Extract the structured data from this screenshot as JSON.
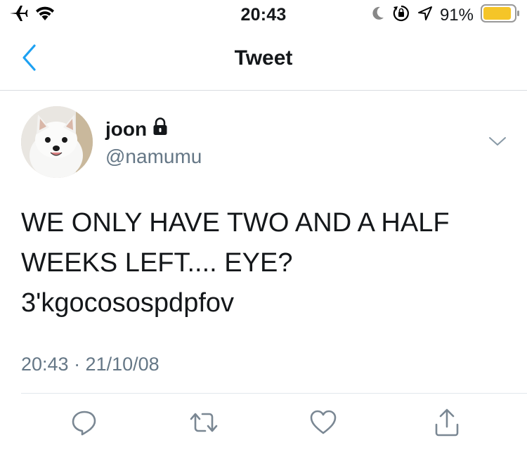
{
  "status_bar": {
    "time": "20:43",
    "battery_percent": "91%",
    "battery_level": 0.91,
    "icons": [
      "airplane-icon",
      "wifi-icon",
      "moon-icon",
      "orientation-lock-icon",
      "location-icon",
      "battery-icon"
    ]
  },
  "nav": {
    "title": "Tweet",
    "back_icon": "chevron-left-icon"
  },
  "tweet": {
    "name": "joon",
    "handle": "@namumu",
    "protected_icon": "lock-icon",
    "text_lines": [
      "WE ONLY HAVE TWO AND A HALF",
      "WEEKS LEFT.... EYE?",
      "3'kgocosospdpfov"
    ],
    "timestamp": "20:43 · 21/10/08"
  },
  "actions": [
    "reply-icon",
    "retweet-icon",
    "like-icon",
    "share-icon"
  ],
  "colors": {
    "accent": "#1da1f2",
    "secondary_text": "#657786",
    "battery": "#f5c528",
    "action_icon": "#7a8793"
  }
}
